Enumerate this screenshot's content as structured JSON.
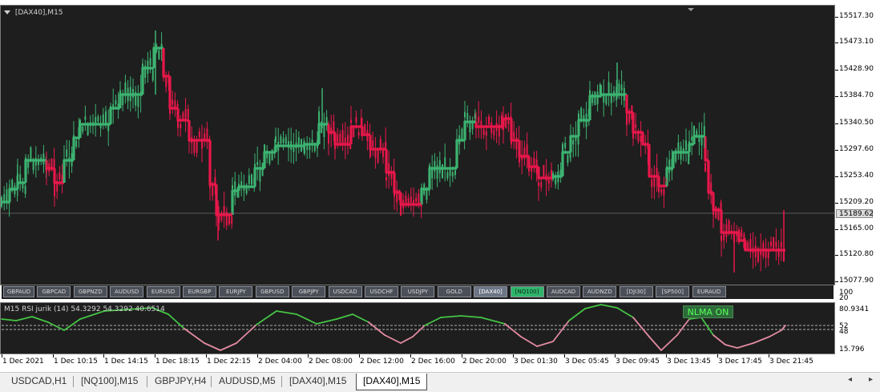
{
  "window": {
    "title": "[DAX40],M15"
  },
  "price_scale": {
    "labels": [
      "15517.30",
      "15473.10",
      "15428.90",
      "15384.70",
      "15340.50",
      "15297.60",
      "15253.40",
      "15209.20",
      "15165.00",
      "15120.80",
      "15077.90"
    ],
    "current_price": "15189.62",
    "subwindow_labels": [
      "100",
      "20"
    ]
  },
  "symbol_buttons": [
    "GBPAUD",
    "GBPCAD",
    "GBPNZD",
    "AUDUSD",
    "EURUSD",
    "EURGBP",
    "EURJPY",
    "GBPUSD",
    "GBPJPY",
    "USDCAD",
    "USDCHF",
    "USDJPY",
    "GOLD",
    "[DAX40]",
    "[NQ100]",
    "AUDCAD",
    "AUDNZD",
    "[DJI30]",
    "[SP500]",
    "EURAUD"
  ],
  "indicator": {
    "label": "M15  RSI jurik (14) 54.3292 54.3292 40.6514",
    "badge": "NLMA ON",
    "scale": [
      "80.9341",
      "52",
      "48",
      "15.796"
    ]
  },
  "time_axis": [
    "1 Dec 2021",
    "1 Dec 10:15",
    "1 Dec 14:15",
    "1 Dec 18:15",
    "1 Dec 22:15",
    "2 Dec 04:00",
    "2 Dec 08:00",
    "2 Dec 12:00",
    "2 Dec 16:00",
    "2 Dec 20:00",
    "3 Dec 01:30",
    "3 Dec 05:45",
    "3 Dec 09:45",
    "3 Dec 13:45",
    "3 Dec 17:45",
    "3 Dec 21:45"
  ],
  "tabs": [
    "USDCAD,H1",
    "[NQ100],M15",
    "GBPJPY,H4",
    "AUDUSD,M5",
    "[DAX40],M15",
    "[DAX40],M15"
  ],
  "active_tab": 5,
  "colors": {
    "bull": "#3cb371",
    "bear": "#e8174a",
    "rsi_up": "#44c444",
    "rsi_down": "#e28aa0",
    "background": "#1e1e1e"
  },
  "icons": [
    "chart-menu-triangle-icon",
    "tab-scroll-left-icon",
    "tab-scroll-right-icon"
  ]
}
